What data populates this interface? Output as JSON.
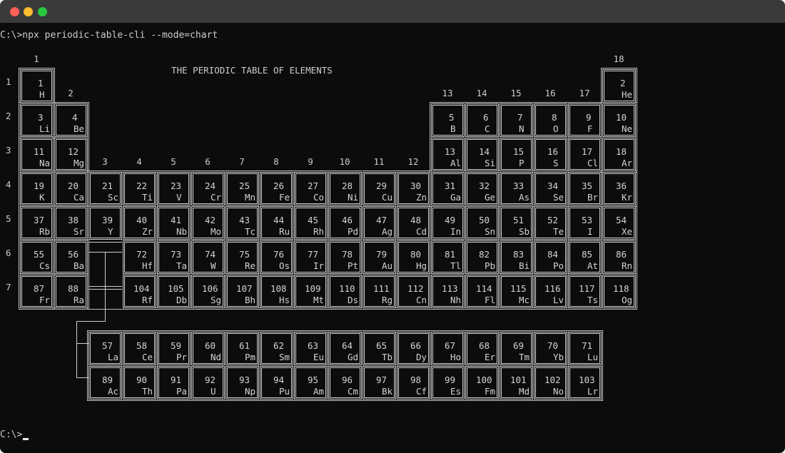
{
  "window": {
    "traffic_lights": [
      {
        "name": "close",
        "color": "#ff5f57"
      },
      {
        "name": "minimize",
        "color": "#febc2e"
      },
      {
        "name": "maximize",
        "color": "#28c840"
      }
    ],
    "titlebar_color": "#3a3a3a"
  },
  "terminal": {
    "command_line": "C:\\>npx periodic-table-cli --mode=chart",
    "prompt_line": "C:\\>",
    "background": "#0c0c0c",
    "foreground": "#cccccc"
  },
  "table": {
    "title": "THE PERIODIC TABLE OF ELEMENTS",
    "group_labels": [
      "1",
      "2",
      "3",
      "4",
      "5",
      "6",
      "7",
      "8",
      "9",
      "10",
      "11",
      "12",
      "13",
      "14",
      "15",
      "16",
      "17",
      "18"
    ],
    "period_labels": [
      "1",
      "2",
      "3",
      "4",
      "5",
      "6",
      "7"
    ],
    "elements": [
      [
        "1",
        "H"
      ],
      [
        "2",
        "He"
      ],
      [
        "3",
        "Li"
      ],
      [
        "4",
        "Be"
      ],
      [
        "5",
        "B"
      ],
      [
        "6",
        "C"
      ],
      [
        "7",
        "N"
      ],
      [
        "8",
        "O"
      ],
      [
        "9",
        "F"
      ],
      [
        "10",
        "Ne"
      ],
      [
        "11",
        "Na"
      ],
      [
        "12",
        "Mg"
      ],
      [
        "13",
        "Al"
      ],
      [
        "14",
        "Si"
      ],
      [
        "15",
        "P"
      ],
      [
        "16",
        "S"
      ],
      [
        "17",
        "Cl"
      ],
      [
        "18",
        "Ar"
      ],
      [
        "19",
        "K"
      ],
      [
        "20",
        "Ca"
      ],
      [
        "21",
        "Sc"
      ],
      [
        "22",
        "Ti"
      ],
      [
        "23",
        "V"
      ],
      [
        "24",
        "Cr"
      ],
      [
        "25",
        "Mn"
      ],
      [
        "26",
        "Fe"
      ],
      [
        "27",
        "Co"
      ],
      [
        "28",
        "Ni"
      ],
      [
        "29",
        "Cu"
      ],
      [
        "30",
        "Zn"
      ],
      [
        "31",
        "Ga"
      ],
      [
        "32",
        "Ge"
      ],
      [
        "33",
        "As"
      ],
      [
        "34",
        "Se"
      ],
      [
        "35",
        "Br"
      ],
      [
        "36",
        "Kr"
      ],
      [
        "37",
        "Rb"
      ],
      [
        "38",
        "Sr"
      ],
      [
        "39",
        "Y"
      ],
      [
        "40",
        "Zr"
      ],
      [
        "41",
        "Nb"
      ],
      [
        "42",
        "Mo"
      ],
      [
        "43",
        "Tc"
      ],
      [
        "44",
        "Ru"
      ],
      [
        "45",
        "Rh"
      ],
      [
        "46",
        "Pd"
      ],
      [
        "47",
        "Ag"
      ],
      [
        "48",
        "Cd"
      ],
      [
        "49",
        "In"
      ],
      [
        "50",
        "Sn"
      ],
      [
        "51",
        "Sb"
      ],
      [
        "52",
        "Te"
      ],
      [
        "53",
        "I"
      ],
      [
        "54",
        "Xe"
      ],
      [
        "55",
        "Cs"
      ],
      [
        "56",
        "Ba"
      ],
      [
        "57",
        "La"
      ],
      [
        "58",
        "Ce"
      ],
      [
        "59",
        "Pr"
      ],
      [
        "60",
        "Nd"
      ],
      [
        "61",
        "Pm"
      ],
      [
        "62",
        "Sm"
      ],
      [
        "63",
        "Eu"
      ],
      [
        "64",
        "Gd"
      ],
      [
        "65",
        "Tb"
      ],
      [
        "66",
        "Dy"
      ],
      [
        "67",
        "Ho"
      ],
      [
        "68",
        "Er"
      ],
      [
        "69",
        "Tm"
      ],
      [
        "70",
        "Yb"
      ],
      [
        "71",
        "Lu"
      ],
      [
        "72",
        "Hf"
      ],
      [
        "73",
        "Ta"
      ],
      [
        "74",
        "W"
      ],
      [
        "75",
        "Re"
      ],
      [
        "76",
        "Os"
      ],
      [
        "77",
        "Ir"
      ],
      [
        "78",
        "Pt"
      ],
      [
        "79",
        "Au"
      ],
      [
        "80",
        "Hg"
      ],
      [
        "81",
        "Tl"
      ],
      [
        "82",
        "Pb"
      ],
      [
        "83",
        "Bi"
      ],
      [
        "84",
        "Po"
      ],
      [
        "85",
        "At"
      ],
      [
        "86",
        "Rn"
      ],
      [
        "87",
        "Fr"
      ],
      [
        "88",
        "Ra"
      ],
      [
        "89",
        "Ac"
      ],
      [
        "90",
        "Th"
      ],
      [
        "91",
        "Pa"
      ],
      [
        "92",
        "U"
      ],
      [
        "93",
        "Np"
      ],
      [
        "94",
        "Pu"
      ],
      [
        "95",
        "Am"
      ],
      [
        "96",
        "Cm"
      ],
      [
        "97",
        "Bk"
      ],
      [
        "98",
        "Cf"
      ],
      [
        "99",
        "Es"
      ],
      [
        "100",
        "Fm"
      ],
      [
        "101",
        "Md"
      ],
      [
        "102",
        "No"
      ],
      [
        "103",
        "Lr"
      ],
      [
        "104",
        "Rf"
      ],
      [
        "105",
        "Db"
      ],
      [
        "106",
        "Sg"
      ],
      [
        "107",
        "Bh"
      ],
      [
        "108",
        "Hs"
      ],
      [
        "109",
        "Mt"
      ],
      [
        "110",
        "Ds"
      ],
      [
        "111",
        "Rg"
      ],
      [
        "112",
        "Cn"
      ],
      [
        "113",
        "Nh"
      ],
      [
        "114",
        "Fl"
      ],
      [
        "115",
        "Mc"
      ],
      [
        "116",
        "Lv"
      ],
      [
        "117",
        "Ts"
      ],
      [
        "118",
        "Og"
      ]
    ]
  }
}
